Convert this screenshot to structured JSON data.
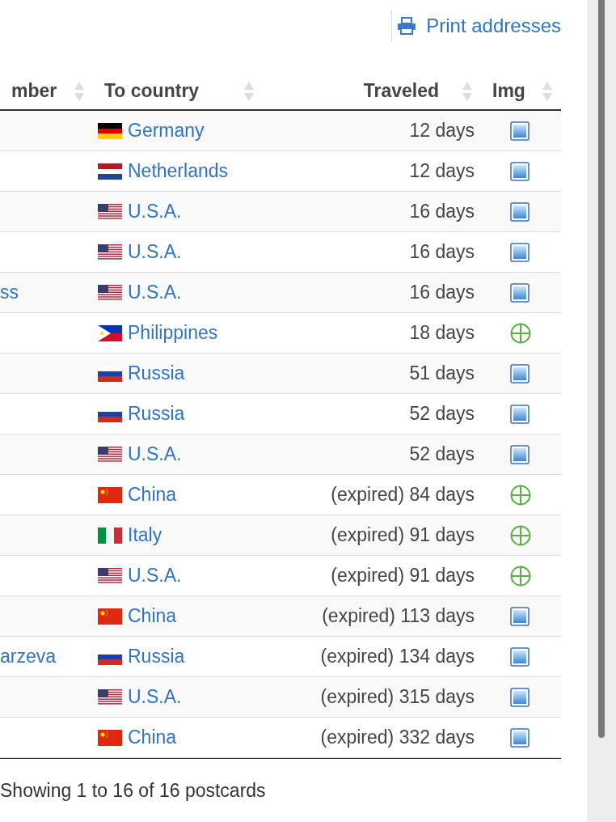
{
  "print_link": "Print addresses",
  "columns": [
    "mber",
    "To country",
    "Traveled",
    "Img"
  ],
  "rows": [
    {
      "column_1": "",
      "country": {
        "name": "Germany",
        "kind": "de"
      },
      "traveled": "12 days",
      "img": {
        "kind": "photo"
      }
    },
    {
      "column_1": "",
      "country": {
        "name": "Netherlands",
        "kind": "nl"
      },
      "traveled": "12 days",
      "img": {
        "kind": "photo"
      }
    },
    {
      "column_1": "",
      "country": {
        "name": "U.S.A.",
        "kind": "us"
      },
      "traveled": "16 days",
      "img": {
        "kind": "photo"
      }
    },
    {
      "column_1": "",
      "country": {
        "name": "U.S.A.",
        "kind": "us"
      },
      "traveled": "16 days",
      "img": {
        "kind": "photo"
      }
    },
    {
      "column_1": "ss",
      "country": {
        "name": "U.S.A.",
        "kind": "us"
      },
      "traveled": "16 days",
      "img": {
        "kind": "photo"
      }
    },
    {
      "column_1": "",
      "country": {
        "name": "Philippines",
        "kind": "ph"
      },
      "traveled": "18 days",
      "img": {
        "kind": "add"
      }
    },
    {
      "column_1": "",
      "country": {
        "name": "Russia",
        "kind": "ru"
      },
      "traveled": "51 days",
      "img": {
        "kind": "photo"
      }
    },
    {
      "column_1": "",
      "country": {
        "name": "Russia",
        "kind": "ru"
      },
      "traveled": "52 days",
      "img": {
        "kind": "photo"
      }
    },
    {
      "column_1": "",
      "country": {
        "name": "U.S.A.",
        "kind": "us"
      },
      "traveled": "52 days",
      "img": {
        "kind": "photo"
      }
    },
    {
      "column_1": "",
      "country": {
        "name": "China",
        "kind": "cn"
      },
      "traveled": "(expired) 84 days",
      "img": {
        "kind": "add"
      }
    },
    {
      "column_1": "",
      "country": {
        "name": "Italy",
        "kind": "it"
      },
      "traveled": "(expired) 91 days",
      "img": {
        "kind": "add"
      }
    },
    {
      "column_1": "",
      "country": {
        "name": "U.S.A.",
        "kind": "us"
      },
      "traveled": "(expired) 91 days",
      "img": {
        "kind": "add"
      }
    },
    {
      "column_1": "",
      "country": {
        "name": "China",
        "kind": "cn"
      },
      "traveled": "(expired) 113 days",
      "img": {
        "kind": "photo"
      }
    },
    {
      "column_1": "arzeva",
      "country": {
        "name": "Russia",
        "kind": "ru"
      },
      "traveled": "(expired) 134 days",
      "img": {
        "kind": "photo"
      }
    },
    {
      "column_1": "",
      "country": {
        "name": "U.S.A.",
        "kind": "us"
      },
      "traveled": "(expired) 315 days",
      "img": {
        "kind": "photo"
      }
    },
    {
      "column_1": "",
      "country": {
        "name": "China",
        "kind": "cn"
      },
      "traveled": "(expired) 332 days",
      "img": {
        "kind": "photo"
      }
    }
  ],
  "footer": "Showing 1 to 16 of 16 postcards"
}
